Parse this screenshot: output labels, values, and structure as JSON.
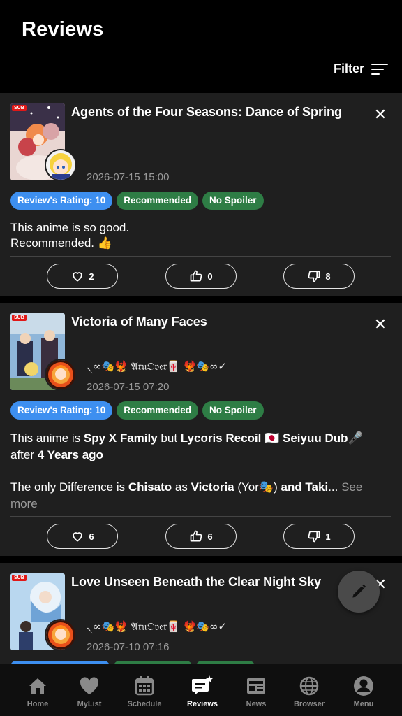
{
  "header": {
    "title": "Reviews",
    "filter_label": "Filter"
  },
  "reviews": [
    {
      "anime_title": "Agents of the Four Seasons: Dance of Spring",
      "poster_badge": "SUB",
      "username": "",
      "timestamp": "2026-07-15 15:00",
      "chips": [
        "Review's Rating: 10",
        "Recommended",
        "No Spoiler"
      ],
      "text_line1": "This anime is so good.",
      "text_line2": "Recommended. 👍",
      "likes": "2",
      "thumbs_up": "0",
      "thumbs_down": "8"
    },
    {
      "anime_title": "Victoria of Many Faces",
      "poster_badge": "SUB",
      "username": "৲∞🎭🐦‍🔥 𝔄𝔯𝔲𝔒𝔳𝔢𝔯🀄 🐦‍🔥🎭∞✓",
      "timestamp": "2026-07-15 07:20",
      "chips": [
        "Review's Rating: 10",
        "Recommended",
        "No Spoiler"
      ],
      "text": {
        "p1_a": "This anime is ",
        "p1_b": "Spy X Family",
        "p1_c": " but ",
        "p1_d": "Lycoris Recoil",
        "p1_e": " 🇯🇵 ",
        "p1_f": "Seiyuu Dub",
        "p1_g": "🎤",
        "p2_a": "after ",
        "p2_b": "4 Years ago",
        "p3_a": "The only Difference is ",
        "p3_b": "Chisato",
        "p3_c": " as ",
        "p3_d": "Victoria",
        "p3_e": " (Yor🎭) ",
        "p3_f": "and Taki",
        "p3_g": "...",
        "see_more": " See more"
      },
      "likes": "6",
      "thumbs_up": "6",
      "thumbs_down": "1"
    },
    {
      "anime_title": "Love Unseen Beneath the Clear Night Sky",
      "poster_badge": "SUB",
      "username": "৲∞🎭🐦‍🔥 𝔄𝔯𝔲𝔒𝔳𝔢𝔯🀄 🐦‍🔥🎭∞✓",
      "timestamp": "2026-07-10 07:16"
    }
  ],
  "tabs": [
    {
      "label": "Home",
      "icon": "home-icon",
      "active": false
    },
    {
      "label": "MyList",
      "icon": "heart-icon",
      "active": false
    },
    {
      "label": "Schedule",
      "icon": "calendar-icon",
      "active": false
    },
    {
      "label": "Reviews",
      "icon": "reviews-icon",
      "active": true
    },
    {
      "label": "News",
      "icon": "news-icon",
      "active": false
    },
    {
      "label": "Browser",
      "icon": "globe-icon",
      "active": false
    },
    {
      "label": "Menu",
      "icon": "account-icon",
      "active": false
    }
  ],
  "colors": {
    "chip_blue": "#3d8ff0",
    "chip_green": "#2e7d45",
    "card_bg": "#1f1f1f",
    "sub_badge": "#e01818"
  }
}
